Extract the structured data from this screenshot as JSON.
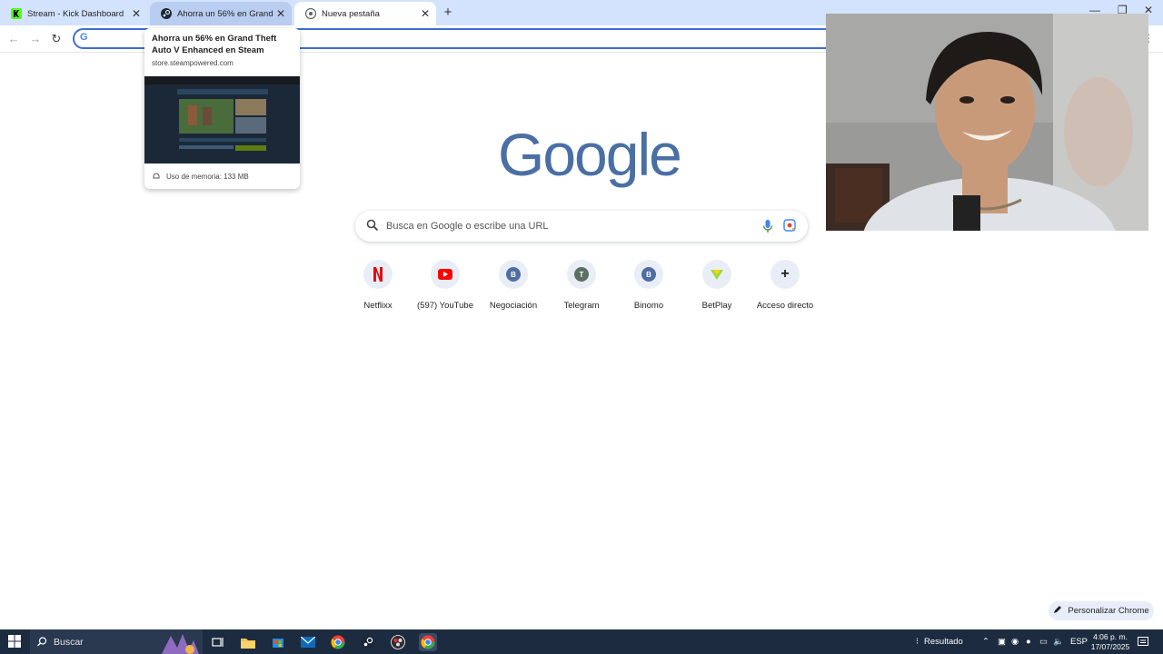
{
  "tabs": [
    {
      "title": "Stream - Kick Dashboard",
      "favicon": "kick-icon"
    },
    {
      "title": "Ahorra un 56% en Grand Theft Auto V Enhanced en Steam",
      "favicon": "steam-icon"
    },
    {
      "title": "Nueva pestaña",
      "favicon": "chrome-icon"
    }
  ],
  "tab_labels": {
    "tab1": "Stream - Kick Dashboard",
    "tab2": "Ahorra un 56% en Grand Theft",
    "tab3": "Nueva pestaña"
  },
  "hovercard": {
    "title": "Ahorra un 56% en Grand Theft Auto V Enhanced en Steam",
    "domain": "store.steampowered.com",
    "memory": "Uso de memoria: 133 MB"
  },
  "logo": "Google",
  "search": {
    "placeholder": "Busca en Google o escribe una URL"
  },
  "shortcuts": [
    {
      "label": "Netflixx",
      "icon": "netflix-icon",
      "color": "#e50914",
      "letter": "N"
    },
    {
      "label": "(597) YouTube",
      "icon": "youtube-icon",
      "color": "#ff0000",
      "letter": ""
    },
    {
      "label": "Negociación",
      "icon": "letter-b-icon",
      "color": "#4f6da0",
      "letter": "B"
    },
    {
      "label": "Telegram",
      "icon": "letter-t-icon",
      "color": "#5b7060",
      "letter": "T"
    },
    {
      "label": "Binomo",
      "icon": "letter-b-icon",
      "color": "#4f6da0",
      "letter": "B"
    },
    {
      "label": "BetPlay",
      "icon": "betplay-icon",
      "color": "#9bd63f",
      "letter": ""
    },
    {
      "label": "Acceso directo",
      "icon": "plus-icon",
      "color": "#1f1f1f",
      "letter": "+"
    }
  ],
  "customize_label": "Personalizar Chrome",
  "taskbar": {
    "search_label": "Buscar",
    "tray_label": "Resultado",
    "lang": "ESP",
    "time": "4:06 p. m.",
    "date": "17/07/2025"
  },
  "colors": {
    "tabstrip": "#d3e3fd",
    "omnibox_border": "#3c6fd6",
    "taskbar": "#1c2b3f",
    "logo": "#4a6fa5"
  }
}
